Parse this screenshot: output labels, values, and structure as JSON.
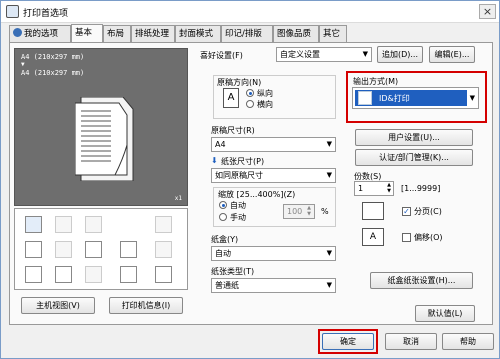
{
  "window": {
    "title": "打印首选项",
    "close": "×"
  },
  "tabs": [
    "我的选项",
    "基本",
    "布局",
    "排纸处理",
    "封面模式",
    "印记/排版",
    "图像品质",
    "其它"
  ],
  "preview": {
    "line1": "A4 (210x297 mm)",
    "arrow": "▼",
    "line2": "A4 (210x297 mm)",
    "copies_mark": "x1"
  },
  "left_buttons": {
    "printer_view": "主机视图(V)",
    "printer_info": "打印机信息(I)"
  },
  "favorites": {
    "label": "喜好设置(F)",
    "value": "自定义设置",
    "add_button": "追加(D)...",
    "edit_button": "编辑(E)..."
  },
  "orientation": {
    "label": "原稿方向(N)",
    "portrait": "纵向",
    "landscape": "横向",
    "selected": "纵向"
  },
  "original_size": {
    "label": "原稿尺寸(R)",
    "value": "A4"
  },
  "paper_size": {
    "label": "纸张尺寸(P)",
    "value": "如同原稿尺寸"
  },
  "zoom": {
    "label": "缩放 [25...400%](Z)",
    "auto": "自动",
    "manual": "手动",
    "value": "100",
    "unit": "%"
  },
  "paper_tray": {
    "label": "纸盒(Y)",
    "value": "自动"
  },
  "paper_type": {
    "label": "纸张类型(T)",
    "value": "普通纸"
  },
  "output": {
    "label": "输出方式(M)",
    "value": "ID&打印"
  },
  "user_settings_button": "用户设置(U)...",
  "auth_button": "认证/部门管理(K)...",
  "copies": {
    "label": "份数(S)",
    "value": "1",
    "range": "[1...9999]"
  },
  "collate": {
    "label": "分页(C)",
    "checked": true
  },
  "offset": {
    "label": "偏移(O)",
    "checked": false
  },
  "paper_tray_settings_button": "纸盒纸张设置(H)...",
  "defaults_button": "默认值(L)",
  "dialog_buttons": {
    "ok": "确定",
    "cancel": "取消",
    "help": "帮助"
  },
  "colors": {
    "highlight_red": "#d40000",
    "selection_blue": "#1f5fbf",
    "preview_gray": "#6e6e6e"
  }
}
